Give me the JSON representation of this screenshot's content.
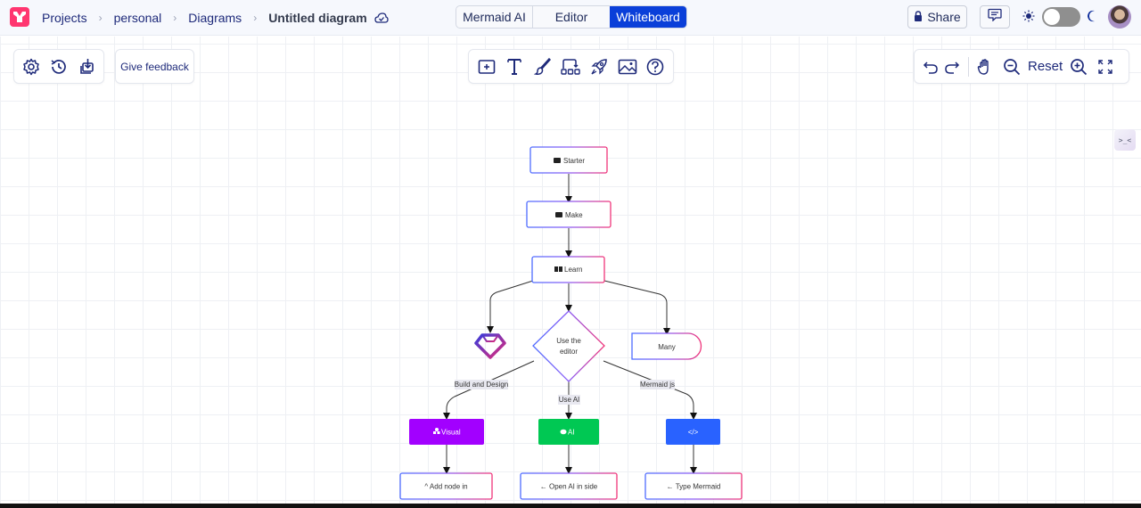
{
  "topbar": {
    "breadcrumbs": [
      "Projects",
      "personal",
      "Diagrams"
    ],
    "diagram_title": "Untitled diagram",
    "mode_tabs": [
      {
        "label": "Mermaid AI",
        "active": false
      },
      {
        "label": "Editor",
        "active": false
      },
      {
        "label": "Whiteboard",
        "active": true
      }
    ],
    "share_label": "Share",
    "theme": "light",
    "icons": {
      "logo": "mermaid-logo-icon",
      "cloud": "cloud-saved-icon",
      "share": "lock-icon",
      "comment": "comment-icon",
      "sun": "sun-icon",
      "moon": "moon-icon"
    },
    "accent_color": "#0a3fd9",
    "logo_color": "#ff3670"
  },
  "toolbar_left": {
    "buttons": [
      "settings-icon",
      "history-icon",
      "download-icon"
    ],
    "feedback_label": "Give feedback"
  },
  "toolbar_center": {
    "tools": [
      "add-shape-icon",
      "text-icon",
      "brush-icon",
      "diagram-icon",
      "rocket-icon",
      "image-icon",
      "help-icon"
    ]
  },
  "toolbar_right": {
    "reset_label": "Reset",
    "tools": [
      "undo-icon",
      "redo-icon",
      "pan-hand-icon",
      "zoom-out-icon",
      "zoom-in-icon",
      "fit-screen-icon"
    ]
  },
  "side_tab": {
    "label": ">_<"
  },
  "diagram": {
    "nodes": [
      {
        "id": "starter",
        "label": "Starter",
        "icon": "▶",
        "shape": "rect"
      },
      {
        "id": "make",
        "label": "Make",
        "icon": "▶",
        "shape": "rect"
      },
      {
        "id": "learn",
        "label": "Learn",
        "icon": "▮▮",
        "shape": "rect"
      },
      {
        "id": "gem",
        "label": "",
        "icon": "gem-icon",
        "shape": "icon"
      },
      {
        "id": "editor",
        "label_lines": [
          "Use the",
          "editor"
        ],
        "shape": "diamond"
      },
      {
        "id": "many",
        "label": "Many",
        "shape": "stadium-right"
      },
      {
        "id": "visual",
        "label": "Visual",
        "icon": "⛬",
        "shape": "filled",
        "color": "#a200ff"
      },
      {
        "id": "ai",
        "label": "AI",
        "icon": "💬",
        "shape": "filled",
        "color": "#00c853"
      },
      {
        "id": "code",
        "label": "</>",
        "shape": "filled",
        "color": "#2962ff"
      },
      {
        "id": "addnode",
        "label": "^ Add node in",
        "shape": "rect"
      },
      {
        "id": "openai",
        "label": "← Open AI in side",
        "shape": "rect"
      },
      {
        "id": "typemermaid",
        "label": "← Type Mermaid",
        "shape": "rect"
      }
    ],
    "edge_labels": {
      "build": "Build and Design",
      "useai": "Use AI",
      "mermaidjs": "Mermaid js"
    },
    "edges": [
      [
        "starter",
        "make"
      ],
      [
        "make",
        "learn"
      ],
      [
        "learn",
        "gem"
      ],
      [
        "learn",
        "editor"
      ],
      [
        "learn",
        "many"
      ],
      [
        "editor",
        "visual",
        "Build and Design"
      ],
      [
        "editor",
        "ai",
        "Use AI"
      ],
      [
        "editor",
        "code",
        "Mermaid js"
      ],
      [
        "visual",
        "addnode"
      ],
      [
        "ai",
        "openai"
      ],
      [
        "code",
        "typemermaid"
      ]
    ]
  }
}
